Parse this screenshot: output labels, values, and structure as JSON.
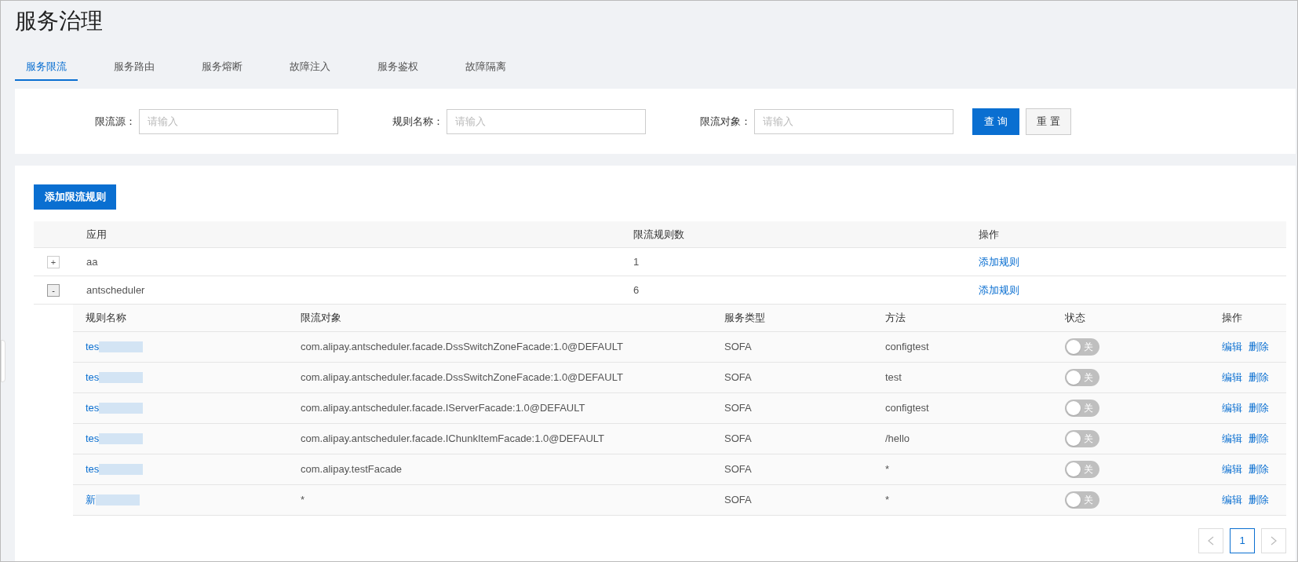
{
  "page_title": "服务治理",
  "tabs": [
    {
      "label": "服务限流",
      "selected": true
    },
    {
      "label": "服务路由",
      "selected": false
    },
    {
      "label": "服务熔断",
      "selected": false
    },
    {
      "label": "故障注入",
      "selected": false
    },
    {
      "label": "服务鉴权",
      "selected": false
    },
    {
      "label": "故障隔离",
      "selected": false
    }
  ],
  "filters": [
    {
      "label": "限流源：",
      "placeholder": "请输入"
    },
    {
      "label": "规则名称：",
      "placeholder": "请输入"
    },
    {
      "label": "限流对象：",
      "placeholder": "请输入"
    }
  ],
  "search_button": "查 询",
  "reset_button": "重 置",
  "add_button": "添加限流规则",
  "table": {
    "columns": [
      "应用",
      "限流规则数",
      "操作"
    ],
    "rows": [
      {
        "expanded": false,
        "expander": "+",
        "app": "aa",
        "count": "1",
        "action": "添加规则"
      },
      {
        "expanded": true,
        "expander": "-",
        "app": "antscheduler",
        "count": "6",
        "action": "添加规则",
        "rules": {
          "columns": [
            "规则名称",
            "限流对象",
            "服务类型",
            "方法",
            "状态",
            "操作"
          ],
          "rows": [
            {
              "name": "tes",
              "target": "com.alipay.antscheduler.facade.DssSwitchZoneFacade:1.0@DEFAULT",
              "type": "SOFA",
              "method": "configtest",
              "on": false,
              "switch_label": "关",
              "edit": "编辑",
              "delete": "删除"
            },
            {
              "name": "tes",
              "target": "com.alipay.antscheduler.facade.DssSwitchZoneFacade:1.0@DEFAULT",
              "type": "SOFA",
              "method": "test",
              "on": false,
              "switch_label": "关",
              "edit": "编辑",
              "delete": "删除"
            },
            {
              "name": "tes",
              "target": "com.alipay.antscheduler.facade.IServerFacade:1.0@DEFAULT",
              "type": "SOFA",
              "method": "configtest",
              "on": false,
              "switch_label": "关",
              "edit": "编辑",
              "delete": "删除"
            },
            {
              "name": "tes",
              "target": "com.alipay.antscheduler.facade.IChunkItemFacade:1.0@DEFAULT",
              "type": "SOFA",
              "method": "/hello",
              "on": false,
              "switch_label": "关",
              "edit": "编辑",
              "delete": "删除"
            },
            {
              "name": "tes",
              "target": "com.alipay.testFacade",
              "type": "SOFA",
              "method": "*",
              "on": false,
              "switch_label": "关",
              "edit": "编辑",
              "delete": "删除"
            },
            {
              "name": "新",
              "target": "*",
              "type": "SOFA",
              "method": "*",
              "on": false,
              "switch_label": "关",
              "edit": "编辑",
              "delete": "删除"
            }
          ]
        }
      }
    ]
  },
  "pagination": {
    "pages": [
      {
        "label": "1",
        "selected": true
      }
    ]
  }
}
